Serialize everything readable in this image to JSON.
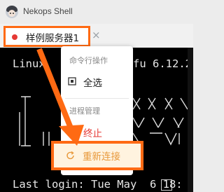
{
  "app": {
    "title": "Nekops Shell"
  },
  "tab": {
    "label": "样例服务器1",
    "close": "×",
    "status_color": "#e53935"
  },
  "terminal": {
    "line1": "Linux ",
    "line1_right": "fu 6.12.2",
    "last_login": "Last login: Tue May  6 18:"
  },
  "menu": {
    "group_command": "命令行操作",
    "select_all": "全选",
    "group_process": "进程管理",
    "stop": "终止",
    "reconnect": "重新连接"
  },
  "colors": {
    "highlight": "#ff6a13",
    "danger": "#e53935",
    "accent": "#f0a24a"
  }
}
